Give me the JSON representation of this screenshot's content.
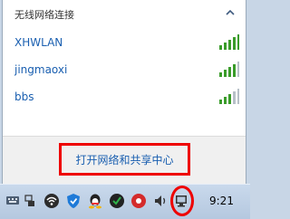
{
  "popup": {
    "section_title": "无线网络连接",
    "networks": [
      {
        "name": "XHWLAN"
      },
      {
        "name": "jingmaoxi"
      },
      {
        "name": "bbs"
      }
    ],
    "open_center_label": "打开网络和共享中心"
  },
  "taskbar": {
    "time": "9:21",
    "icons": [
      "keyboard-icon",
      "pinyin-toggle-icon",
      "wifi-tray-icon",
      "shield-icon",
      "qq-icon",
      "antivirus-icon",
      "red-app-icon",
      "volume-icon",
      "network-tray-icon"
    ]
  },
  "colors": {
    "link_blue": "#1a5fb0",
    "highlight_red": "#ee0000",
    "signal_green": "#3a9c2a"
  }
}
